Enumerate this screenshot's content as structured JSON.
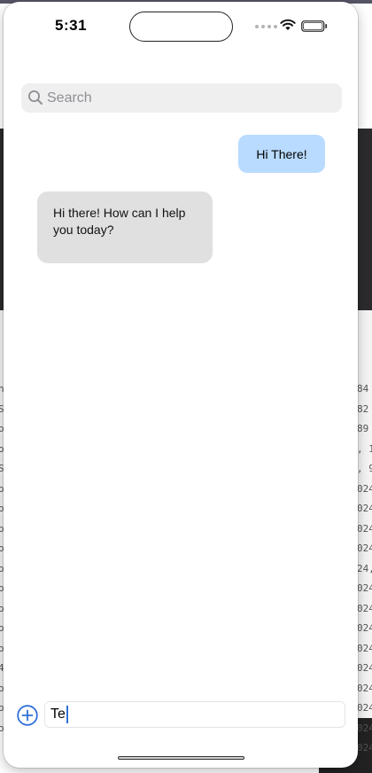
{
  "status_bar": {
    "time": "5:31"
  },
  "search": {
    "placeholder": "Search",
    "icon": "magnifier"
  },
  "messages": [
    {
      "role": "user",
      "text": "Hi There!"
    },
    {
      "role": "assistant",
      "text": "Hi there! How can I help you today?"
    }
  ],
  "composer": {
    "value": "Te",
    "add_icon": "plus-circle"
  },
  "background_edge": {
    "left_chars": "h\nS\not\not\nS\not\not\not\not\not\not\not\not\not\n4\not\not\not",
    "right_chars": "84\n82\n89\n, 1\n, 9\n024\n024\n024\n024\n24,\n024\n024\n024\n024\n024\n024\n024\n024\n024"
  },
  "colors": {
    "user_bubble": "#b8dbff",
    "assistant_bubble": "#e0e0e0",
    "accent": "#2f6fd8"
  }
}
